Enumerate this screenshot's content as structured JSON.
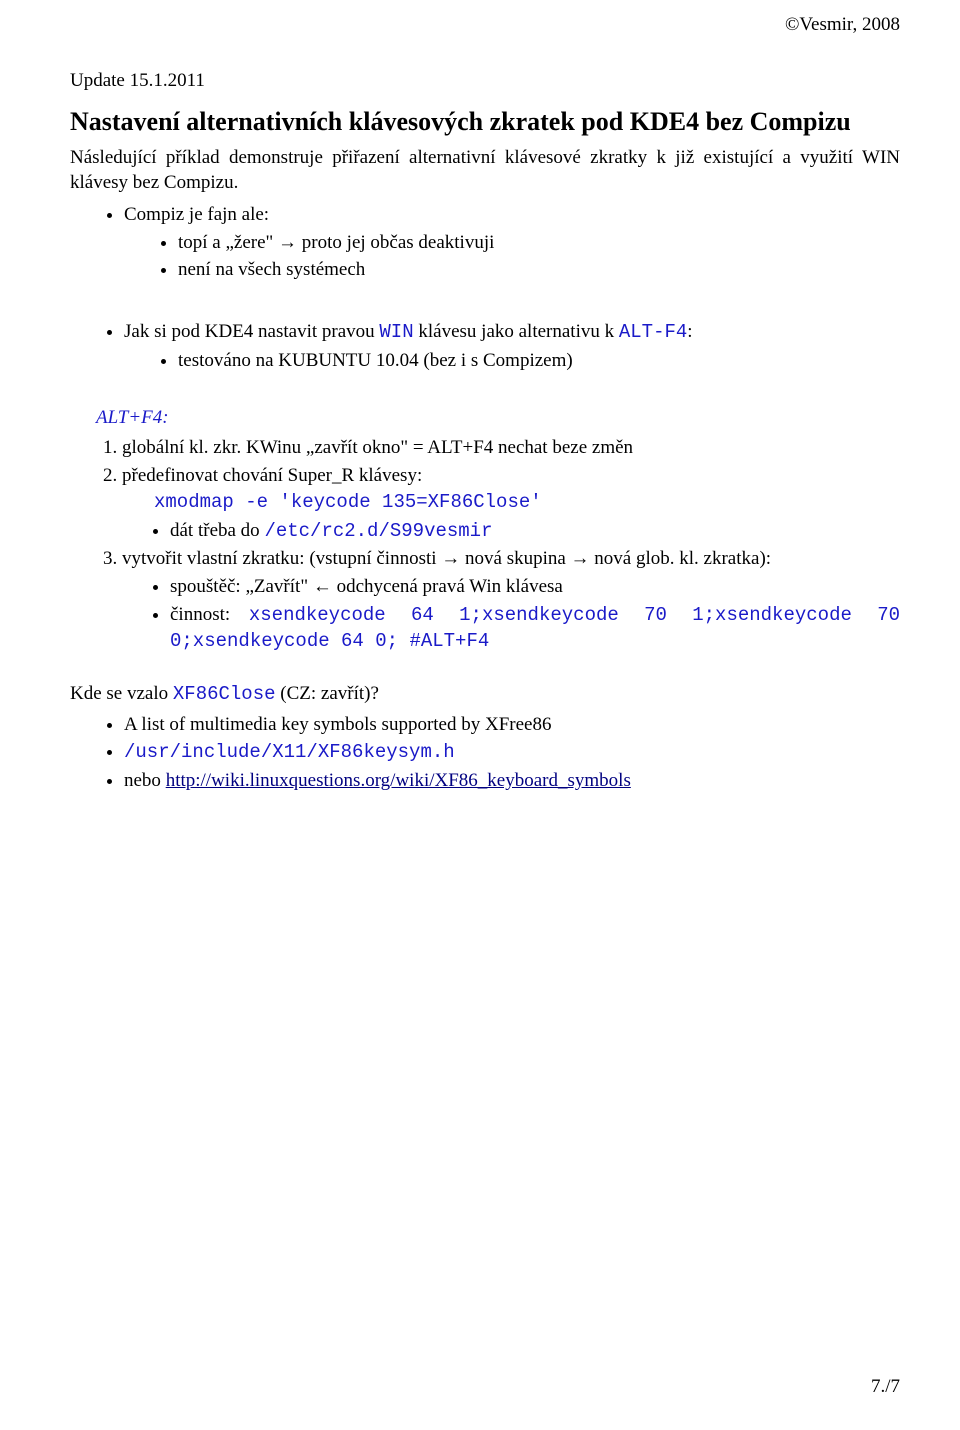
{
  "header": {
    "copyright": "©Vesmir, 2008"
  },
  "update": "Update 15.1.2011",
  "title": "Nastavení alternativních klávesových zkratek pod KDE4 bez Compizu",
  "intro": "Následující příklad demonstruje přiřazení alternativní klávesové zkratky k již existující a využití WIN klávesy bez Compizu.",
  "bulletsA": {
    "compiz": "Compiz je fajn ale:",
    "sub1": "topí a „žere\" → proto jej občas deaktivuji",
    "sub2": "není na všech systémech",
    "jak_pre": "Jak si pod KDE4 nastavit pravou ",
    "jak_win": "WIN",
    "jak_mid": " klávesu jako alternativu k ",
    "jak_alt": "ALT-F4",
    "jak_post": ":",
    "test": "testováno na KUBUNTU 10.04 (bez i s Compizem)"
  },
  "altf4_label": "ALT+F4:",
  "steps": {
    "s1": "globální kl. zkr. KWinu „zavřít okno\" = ALT+F4 nechat beze změn",
    "s2_text": "předefinovat chování Super_R klávesy:",
    "s2_code": "xmodmap -e 'keycode 135=XF86Close'",
    "s2_sub_pre": "dát třeba do ",
    "s2_sub_code": "/etc/rc2.d/S99vesmir",
    "s3_text": "vytvořit vlastní zkratku: (vstupní činnosti → nová skupina → nová glob. kl. zkratka):",
    "s3_sub1": "spouštěč: „Zavřít\" ← odchycená pravá Win klávesa",
    "s3_sub2_label": "činnost:",
    "s3_sub2_code_a": "xsendkeycode 64 1;xsendkeycode 70 1;xsendkeycode 70 0;xsendkeycode 64 0; #ALT+F4"
  },
  "footer": {
    "q_pre": "Kde se vzalo ",
    "q_code": "XF86Close",
    "q_post": "  (CZ: zavřít)?",
    "list1": "A list of multimedia key symbols supported by XFree86",
    "list2_code": "/usr/include/X11/XF86keysym.h",
    "list3_pre": "nebo ",
    "list3_link": "http://wiki.linuxquestions.org/wiki/XF86_keyboard_symbols"
  },
  "pagenum": "7./7"
}
